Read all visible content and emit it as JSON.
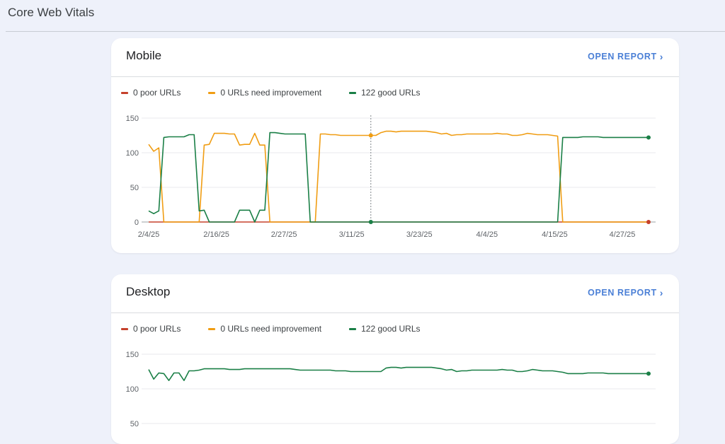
{
  "page": {
    "title": "Core Web Vitals"
  },
  "colors": {
    "poor": "#c5402b",
    "ni": "#f09d13",
    "good": "#1a7f46",
    "accent": "#4a7fd6"
  },
  "mobile": {
    "title": "Mobile",
    "open_report": "OPEN REPORT",
    "legend": [
      "0 poor URLs",
      "0 URLs need improvement",
      "122 good URLs"
    ],
    "chart_data": {
      "type": "line",
      "yticks": [
        0,
        50,
        100,
        150
      ],
      "ylim": [
        0,
        150
      ],
      "xticks": [
        "2/4/25",
        "2/16/25",
        "2/27/25",
        "3/11/25",
        "3/23/25",
        "4/4/25",
        "4/15/25",
        "4/27/25"
      ],
      "x": [
        0,
        1,
        2,
        3,
        4,
        5,
        6,
        7,
        8,
        9,
        10,
        11,
        12,
        13,
        14,
        15,
        16,
        17,
        18,
        19,
        20,
        21,
        22,
        23,
        24,
        25,
        26,
        27,
        28,
        29,
        30,
        31,
        32,
        33,
        34,
        35,
        36,
        37,
        38,
        39,
        40,
        41,
        42,
        43,
        44,
        45,
        46,
        47,
        48,
        49,
        50,
        51,
        52,
        53,
        54,
        55,
        56,
        57,
        58,
        59,
        60,
        61,
        62,
        63,
        64,
        65,
        66,
        67,
        68,
        69,
        70,
        71,
        72,
        73,
        74,
        75,
        76,
        77,
        78,
        79,
        80,
        81,
        82,
        83,
        84,
        85,
        86,
        87,
        88,
        89,
        90,
        91,
        92,
        93,
        94,
        95,
        96,
        97,
        98,
        99
      ],
      "series": [
        {
          "name": "0 poor URLs",
          "color": "#c5402b",
          "values": [
            0,
            0,
            0,
            0,
            0,
            0,
            0,
            0,
            0,
            0,
            0,
            0,
            0,
            0,
            0,
            0,
            0,
            0,
            0,
            0,
            0,
            0,
            0,
            0,
            0,
            0,
            0,
            0,
            0,
            0,
            0,
            0,
            0,
            0,
            0,
            0,
            0,
            0,
            0,
            0,
            0,
            0,
            0,
            0,
            0,
            0,
            0,
            0,
            0,
            0,
            0,
            0,
            0,
            0,
            0,
            0,
            0,
            0,
            0,
            0,
            0,
            0,
            0,
            0,
            0,
            0,
            0,
            0,
            0,
            0,
            0,
            0,
            0,
            0,
            0,
            0,
            0,
            0,
            0,
            0,
            0,
            0,
            0,
            0,
            0,
            0,
            0,
            0,
            0,
            0,
            0,
            0,
            0,
            0,
            0,
            0,
            0,
            0,
            0,
            0
          ]
        },
        {
          "name": "0 URLs need improvement",
          "color": "#f09d13",
          "values": [
            112,
            102,
            107,
            0,
            0,
            0,
            0,
            0,
            0,
            0,
            0,
            111,
            112,
            128,
            128,
            128,
            127,
            127,
            111,
            112,
            112,
            128,
            111,
            111,
            0,
            0,
            0,
            0,
            0,
            0,
            0,
            0,
            0,
            0,
            127,
            127,
            126,
            126,
            125,
            125,
            125,
            125,
            125,
            125,
            125,
            125,
            129,
            131,
            131,
            130,
            131,
            131,
            131,
            131,
            131,
            131,
            130,
            129,
            127,
            128,
            125,
            126,
            126,
            127,
            127,
            127,
            127,
            127,
            127,
            128,
            127,
            127,
            125,
            125,
            126,
            128,
            127,
            126,
            126,
            126,
            125,
            124,
            0,
            0,
            0,
            0,
            0,
            0,
            0,
            0,
            0,
            0,
            0,
            0,
            0,
            0,
            0,
            0,
            0,
            0
          ]
        },
        {
          "name": "122 good URLs",
          "color": "#1a7f46",
          "values": [
            16,
            12,
            16,
            122,
            123,
            123,
            123,
            123,
            126,
            126,
            16,
            17,
            0,
            0,
            0,
            0,
            0,
            0,
            17,
            17,
            17,
            0,
            17,
            17,
            129,
            129,
            128,
            127,
            127,
            127,
            127,
            127,
            0,
            0,
            0,
            0,
            0,
            0,
            0,
            0,
            0,
            0,
            0,
            0,
            0,
            0,
            0,
            0,
            0,
            0,
            0,
            0,
            0,
            0,
            0,
            0,
            0,
            0,
            0,
            0,
            0,
            0,
            0,
            0,
            0,
            0,
            0,
            0,
            0,
            0,
            0,
            0,
            0,
            0,
            0,
            0,
            0,
            0,
            0,
            0,
            0,
            0,
            122,
            122,
            122,
            122,
            123,
            123,
            123,
            123,
            122,
            122,
            122,
            122,
            122,
            122,
            122,
            122,
            122,
            122
          ]
        }
      ],
      "hover_x": 44
    }
  },
  "desktop": {
    "title": "Desktop",
    "open_report": "OPEN REPORT",
    "legend": [
      "0 poor URLs",
      "0 URLs need improvement",
      "122 good URLs"
    ],
    "chart_data": {
      "type": "line",
      "yticks": [
        50,
        100,
        150
      ],
      "ylim": [
        0,
        150
      ],
      "x": [
        0,
        1,
        2,
        3,
        4,
        5,
        6,
        7,
        8,
        9,
        10,
        11,
        12,
        13,
        14,
        15,
        16,
        17,
        18,
        19,
        20,
        21,
        22,
        23,
        24,
        25,
        26,
        27,
        28,
        29,
        30,
        31,
        32,
        33,
        34,
        35,
        36,
        37,
        38,
        39,
        40,
        41,
        42,
        43,
        44,
        45,
        46,
        47,
        48,
        49,
        50,
        51,
        52,
        53,
        54,
        55,
        56,
        57,
        58,
        59,
        60,
        61,
        62,
        63,
        64,
        65,
        66,
        67,
        68,
        69,
        70,
        71,
        72,
        73,
        74,
        75,
        76,
        77,
        78,
        79,
        80,
        81,
        82,
        83,
        84,
        85,
        86,
        87,
        88,
        89,
        90,
        91,
        92,
        93,
        94,
        95,
        96,
        97,
        98,
        99
      ],
      "series": [
        {
          "name": "122 good URLs",
          "color": "#1a7f46",
          "values": [
            128,
            114,
            123,
            122,
            112,
            123,
            123,
            112,
            126,
            126,
            127,
            129,
            129,
            129,
            129,
            129,
            128,
            128,
            128,
            129,
            129,
            129,
            129,
            129,
            129,
            129,
            129,
            129,
            129,
            128,
            127,
            127,
            127,
            127,
            127,
            127,
            127,
            126,
            126,
            126,
            125,
            125,
            125,
            125,
            125,
            125,
            125,
            130,
            131,
            131,
            130,
            131,
            131,
            131,
            131,
            131,
            131,
            130,
            129,
            127,
            128,
            125,
            126,
            126,
            127,
            127,
            127,
            127,
            127,
            127,
            128,
            127,
            127,
            125,
            125,
            126,
            128,
            127,
            126,
            126,
            126,
            125,
            124,
            122,
            122,
            122,
            122,
            123,
            123,
            123,
            123,
            122,
            122,
            122,
            122,
            122,
            122,
            122,
            122,
            122
          ]
        }
      ]
    }
  }
}
